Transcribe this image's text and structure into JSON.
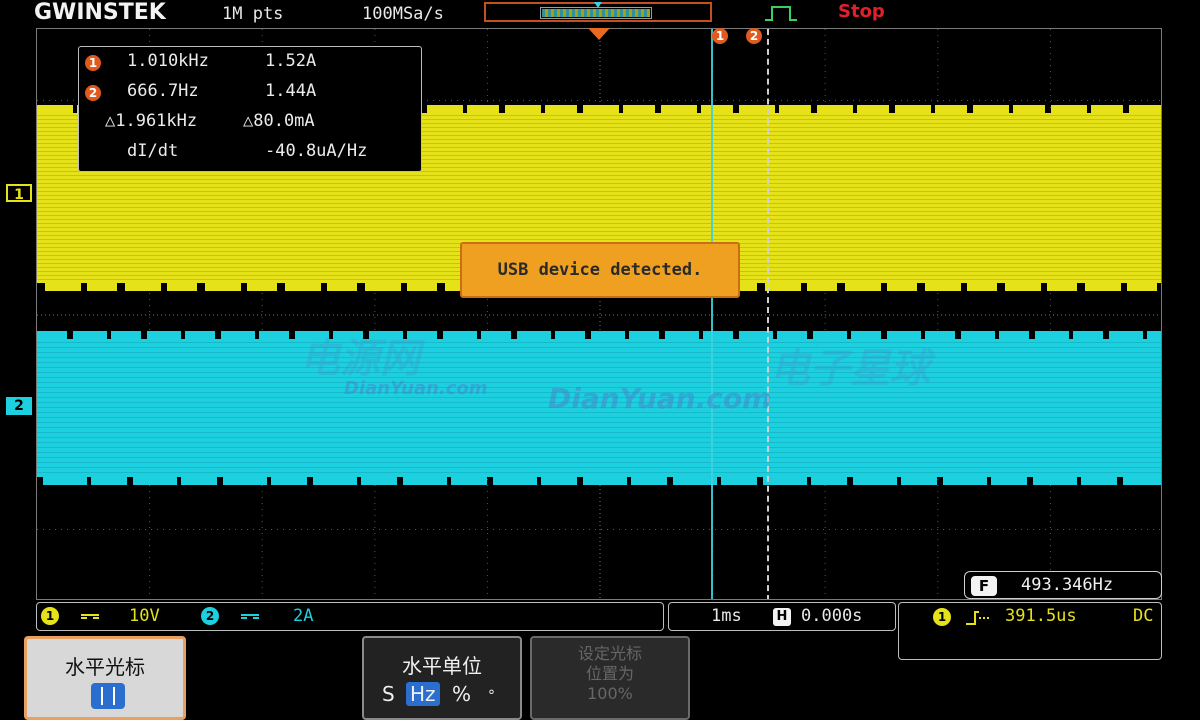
{
  "top_bar": {
    "brand": "GWINSTEK",
    "record_length": "1M pts",
    "sample_rate": "100MSa/s",
    "run_status": "Stop"
  },
  "cursor_readout": {
    "rows": [
      {
        "badge": "1",
        "col1": "1.010kHz",
        "col2": "1.52A"
      },
      {
        "badge": "2",
        "col1": "666.7Hz",
        "col2": "1.44A"
      },
      {
        "badge": "",
        "col1": "△1.961kHz",
        "col2": "△80.0mA"
      },
      {
        "badge": "",
        "col1": "dI/dt",
        "col2": "-40.8uA/Hz"
      }
    ]
  },
  "cursor_labels": [
    "1",
    "2"
  ],
  "channel_markers": {
    "ch1": "1",
    "ch2": "2"
  },
  "popup": {
    "message": "USB device detected."
  },
  "frequency_counter": {
    "icon": "F",
    "value": "493.346Hz"
  },
  "channel_status": {
    "ch1": {
      "num": "1",
      "scale": "10V",
      "color": "#e6e21a"
    },
    "ch2": {
      "num": "2",
      "scale": "2A",
      "color": "#1dd0df"
    }
  },
  "timebase": {
    "scale": "1ms",
    "icon": "H",
    "position": "0.000s"
  },
  "trigger": {
    "source": "1",
    "level": "391.5us",
    "coupling": "DC"
  },
  "soft_menu": {
    "cursor_h": {
      "label": "水平光标"
    },
    "unit": {
      "label": "水平单位",
      "options": [
        "S",
        "Hz",
        "%",
        "°"
      ],
      "selected": "Hz"
    },
    "disabled": {
      "line1": "设定光标",
      "line2": "位置为",
      "line3": "100%"
    }
  },
  "watermark": {
    "cn1": "电源网",
    "en1": "DianYuan.com",
    "cn2": "电子星球",
    "en2": "DianYuan.com"
  },
  "colors": {
    "ch1": "#e6e21a",
    "ch2": "#1dd0df",
    "accent": "#e05a1e",
    "popup": "#f0a020"
  }
}
